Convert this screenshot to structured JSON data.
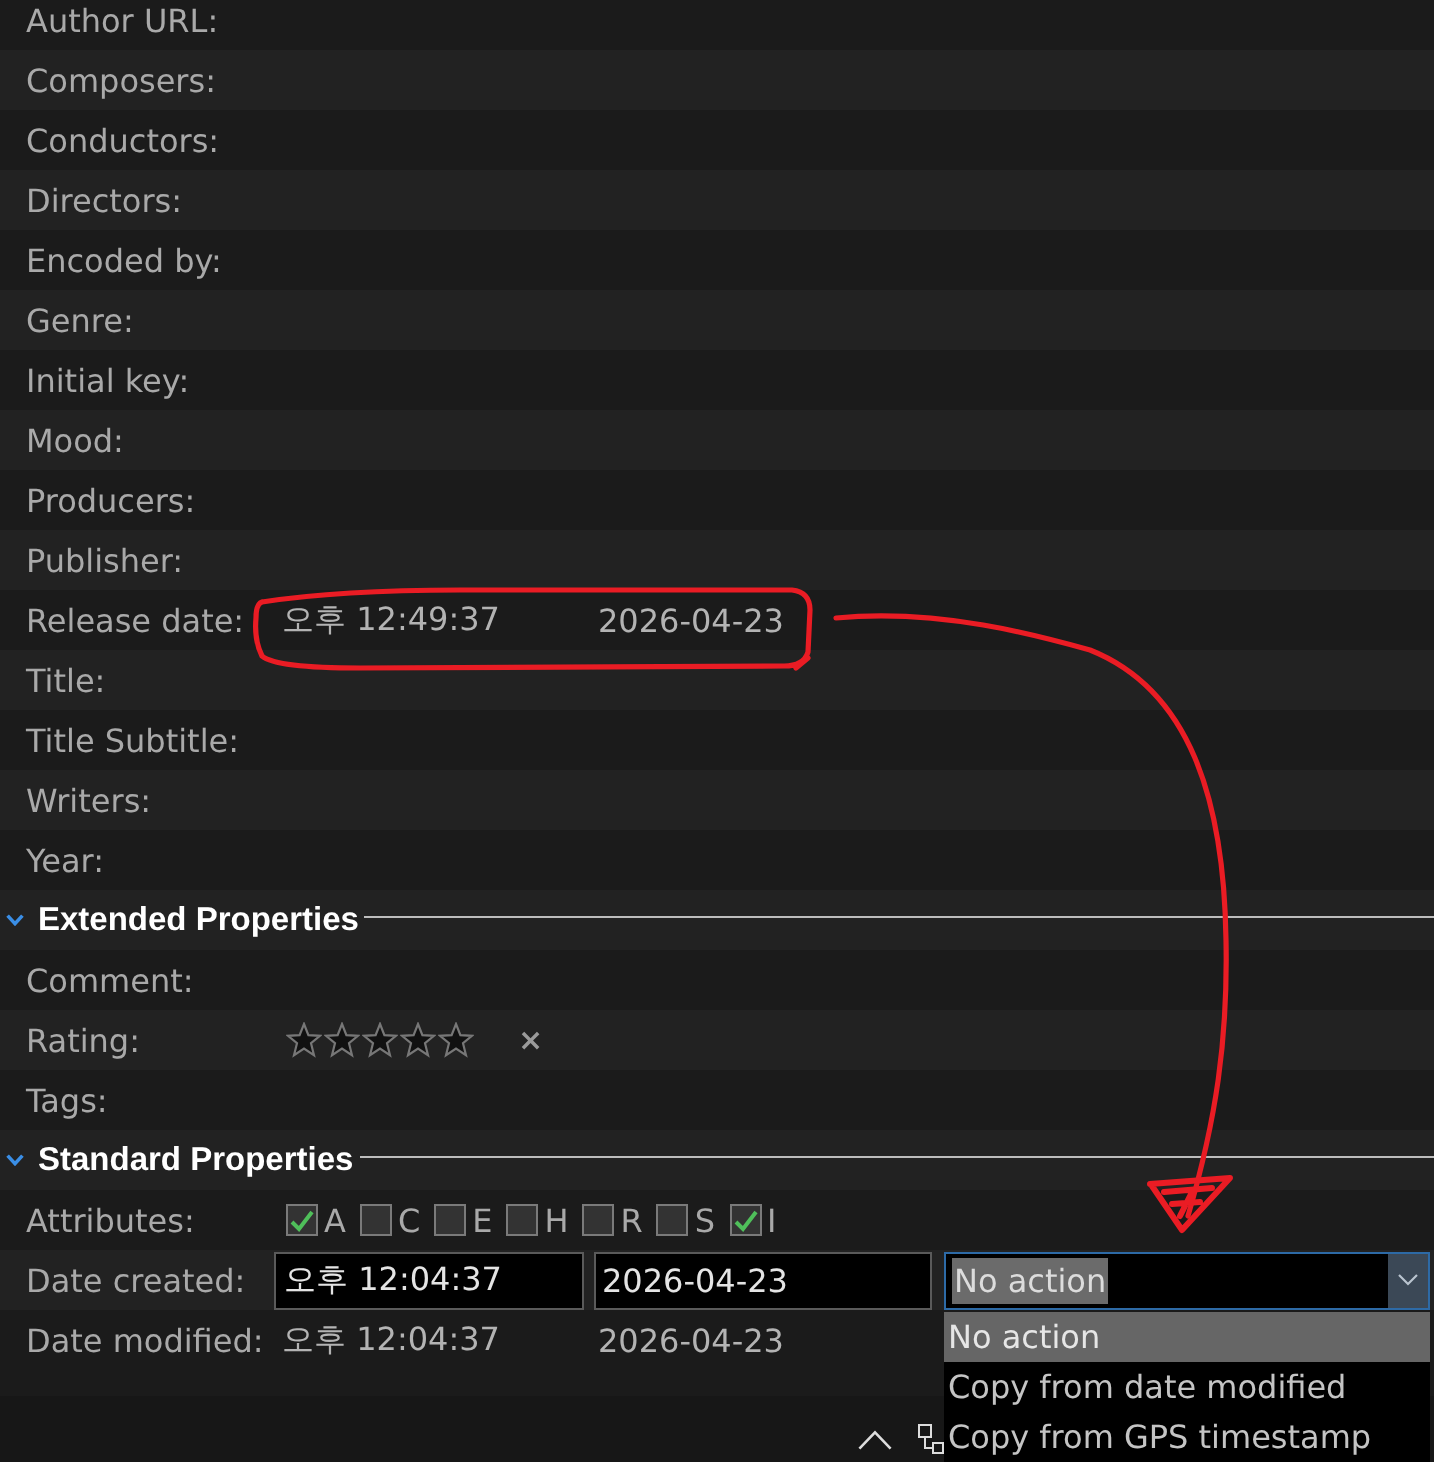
{
  "properties": [
    {
      "kind": "text",
      "label": "Author URL:"
    },
    {
      "kind": "text",
      "label": "Composers:"
    },
    {
      "kind": "text",
      "label": "Conductors:"
    },
    {
      "kind": "text",
      "label": "Directors:"
    },
    {
      "kind": "text",
      "label": "Encoded by:"
    },
    {
      "kind": "text",
      "label": "Genre:"
    },
    {
      "kind": "text",
      "label": "Initial key:"
    },
    {
      "kind": "text",
      "label": "Mood:"
    },
    {
      "kind": "text",
      "label": "Producers:"
    },
    {
      "kind": "text",
      "label": "Publisher:"
    },
    {
      "kind": "datetime",
      "label": "Release date:",
      "time": "오후 12:49:37",
      "date": "2026-04-23"
    },
    {
      "kind": "text",
      "label": "Title:"
    },
    {
      "kind": "text",
      "label": "Title Subtitle:"
    },
    {
      "kind": "text",
      "label": "Writers:"
    },
    {
      "kind": "text",
      "label": "Year:"
    }
  ],
  "sections": [
    {
      "title": "Extended Properties",
      "expanded": true,
      "rows": [
        {
          "kind": "text",
          "label": "Comment:"
        },
        {
          "kind": "rating",
          "label": "Rating:",
          "stars": 0,
          "clear": "×"
        },
        {
          "kind": "text",
          "label": "Tags:"
        }
      ]
    },
    {
      "title": "Standard Properties",
      "expanded": true,
      "rows": [
        {
          "kind": "attributes",
          "label": "Attributes:",
          "attributes": [
            {
              "letter": "A",
              "checked": true
            },
            {
              "letter": "C",
              "checked": false
            },
            {
              "letter": "E",
              "checked": false
            },
            {
              "letter": "H",
              "checked": false
            },
            {
              "letter": "R",
              "checked": false
            },
            {
              "letter": "S",
              "checked": false
            },
            {
              "letter": "I",
              "checked": true
            }
          ]
        },
        {
          "kind": "datetime_edit",
          "label": "Date created:",
          "time": "오후 12:04:37",
          "date": "2026-04-23",
          "action": {
            "value": "No action",
            "open": true,
            "options": [
              {
                "label": "No action",
                "selected": true
              },
              {
                "label": "Copy from date modified",
                "selected": false
              },
              {
                "label": "Copy from GPS timestamp",
                "selected": false
              }
            ]
          }
        },
        {
          "kind": "datetime",
          "label": "Date modified:",
          "time": "오후 12:04:37",
          "date": "2026-04-23"
        }
      ]
    }
  ]
}
